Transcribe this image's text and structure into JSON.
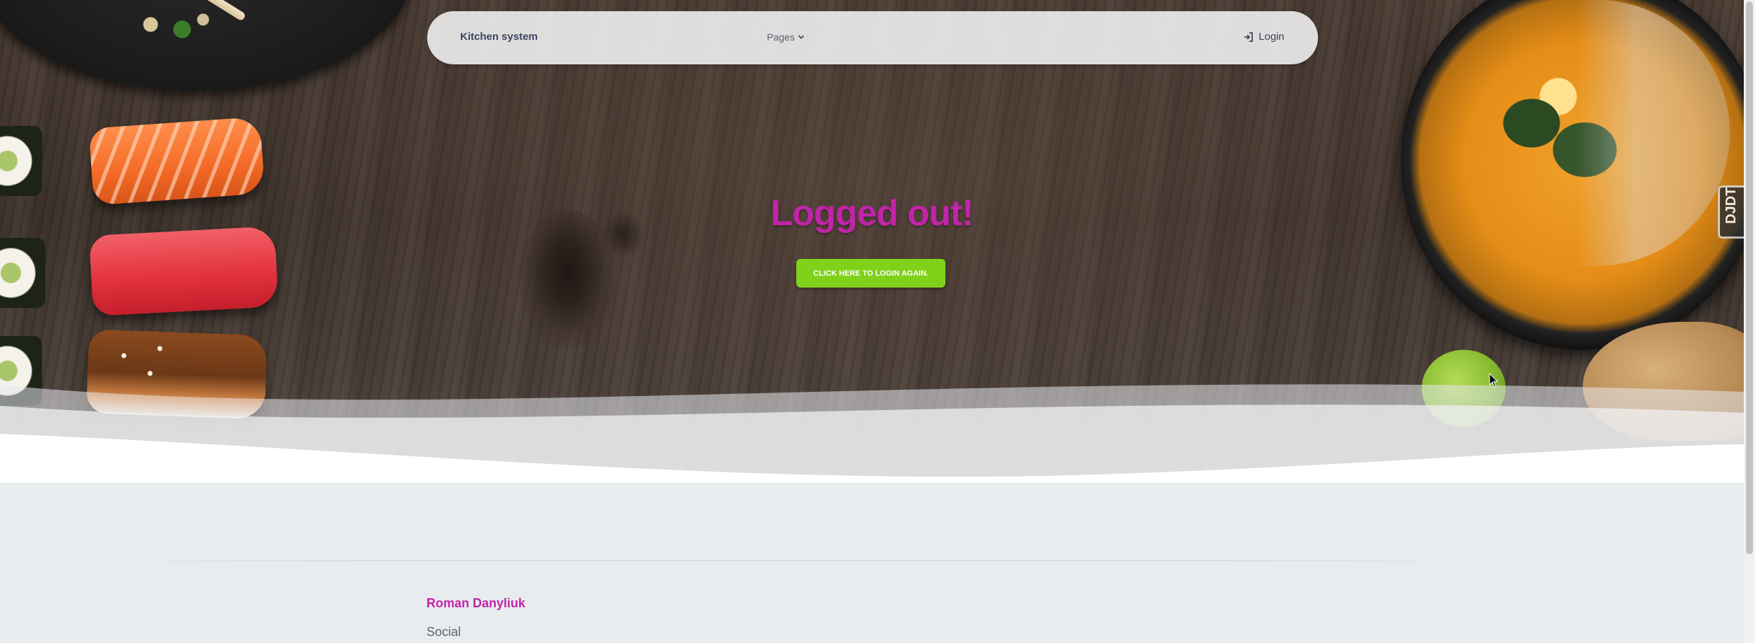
{
  "navbar": {
    "brand": "Kitchen system",
    "pages_label": "Pages",
    "login_label": "Login",
    "icons": {
      "pages_dropdown": "chevron-down-icon",
      "login": "sign-in-icon"
    }
  },
  "main": {
    "headline": "Logged out!",
    "login_again_button": "Click here to login again."
  },
  "debug_toolbar": {
    "handle_label": "DJDT"
  },
  "footer": {
    "author": "Roman Danyliuk",
    "social_heading": "Social"
  },
  "colors": {
    "accent_magenta": "#c124a8",
    "button_green": "#7fd11a",
    "navbar_bg": "#ebe9e9",
    "footer_bg": "#e9ecef",
    "brand_text": "#3b4660"
  }
}
